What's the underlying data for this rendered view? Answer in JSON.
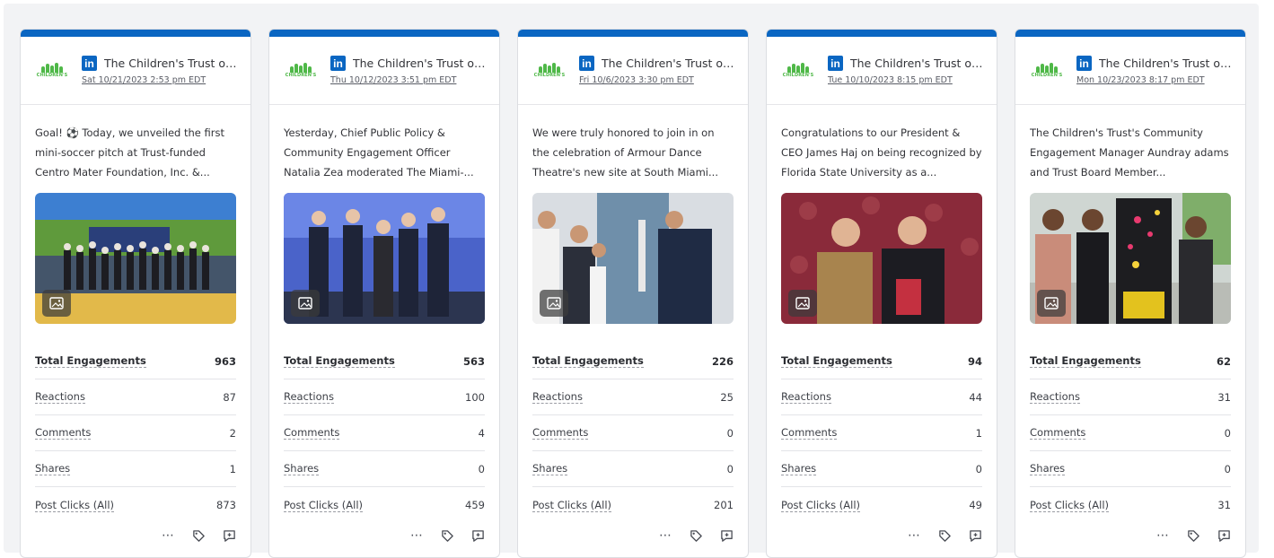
{
  "colors": {
    "linkedin_blue": "#0a66c2",
    "logo_green": "#4fb848"
  },
  "icons": {
    "more": "more-horizontal-icon",
    "tag": "tag-icon",
    "comment": "comment-add-icon",
    "image": "image-icon",
    "network": "linkedin-icon"
  },
  "metric_labels": [
    "Total Engagements",
    "Reactions",
    "Comments",
    "Shares",
    "Post Clicks (All)"
  ],
  "cards": [
    {
      "account": "The Children's Trust of...",
      "date": "Sat 10/21/2023 2:53 pm EDT",
      "text": "Goal! ⚽ Today, we unveiled the first mini-soccer pitch at Trust-funded Centro Mater Foundation, Inc. &...",
      "metrics": [
        "963",
        "87",
        "2",
        "1",
        "873"
      ]
    },
    {
      "account": "The Children's Trust of...",
      "date": "Thu 10/12/2023 3:51 pm EDT",
      "text": "Yesterday, Chief Public Policy & Community Engagement Officer Natalia Zea moderated The Miami-...",
      "metrics": [
        "563",
        "100",
        "4",
        "0",
        "459"
      ]
    },
    {
      "account": "The Children's Trust of...",
      "date": "Fri 10/6/2023 3:30 pm EDT",
      "text": "We were truly honored to join in on the celebration of Armour Dance Theatre's new site at South Miami...",
      "metrics": [
        "226",
        "25",
        "0",
        "0",
        "201"
      ]
    },
    {
      "account": "The Children's Trust of...",
      "date": "Tue 10/10/2023 8:15 pm EDT",
      "text": "Congratulations to our President & CEO James Haj on being recognized by Florida State University as a...",
      "metrics": [
        "94",
        "44",
        "1",
        "0",
        "49"
      ]
    },
    {
      "account": "The Children's Trust of...",
      "date": "Mon 10/23/2023 8:17 pm EDT",
      "text": "The Children's Trust's Community Engagement Manager Aundray adams and Trust Board Member...",
      "metrics": [
        "62",
        "31",
        "0",
        "0",
        "31"
      ]
    }
  ]
}
